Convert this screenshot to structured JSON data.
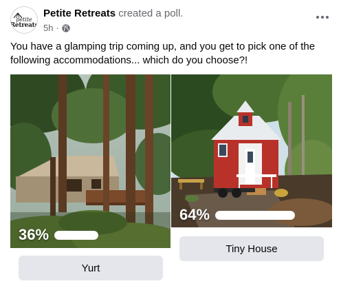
{
  "post": {
    "page_name": "Petite Retreats",
    "action": "created a poll.",
    "timestamp": "5h",
    "separator": "·",
    "audience_icon": "globe-icon",
    "more_icon": "more-horizontal-icon",
    "avatar": {
      "line1": "petite",
      "line2": "Retreats"
    },
    "text": "You have a glamping trip coming up, and you get to pick one of the following accommodations... which do you choose?!"
  },
  "poll": {
    "options": [
      {
        "label": "Yurt",
        "percent_text": "36%",
        "percent": 36
      },
      {
        "label": "Tiny House",
        "percent_text": "64%",
        "percent": 64
      }
    ]
  },
  "colors": {
    "text_primary": "#050505",
    "text_secondary": "#65676b",
    "button_bg": "#e4e6eb",
    "house_red": "#b8322a"
  }
}
